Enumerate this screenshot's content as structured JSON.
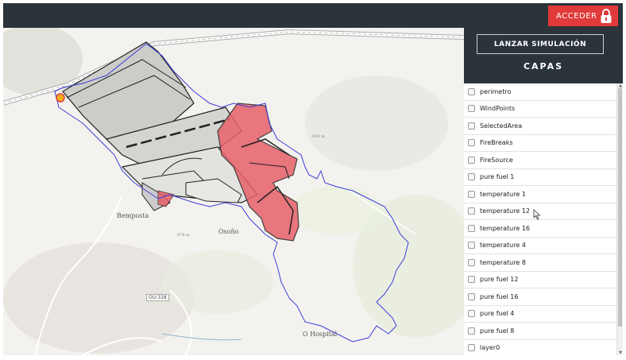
{
  "header": {
    "login_label": "ACCEDER",
    "login_icon": "padlock-icon"
  },
  "panel": {
    "simulate_label": "LANZAR SIMULACIÓN",
    "title": "CAPAS",
    "layers": [
      "perimetro",
      "WindPoints",
      "SelectedArea",
      "FireBreaks",
      "FireSource",
      "pure fuel 1",
      "temperature 1",
      "temperature 12",
      "temperature 16",
      "temperature 4",
      "temperature 8",
      "pure fuel 12",
      "pure fuel 16",
      "pure fuel 4",
      "pure fuel 8",
      "layer0"
    ]
  },
  "map": {
    "places": {
      "bemposta": "Bemposta",
      "osono": "Osoño",
      "hospital": "O Hospital"
    },
    "road_code": "OU-318",
    "elevations": [
      "690 m",
      "678 m"
    ],
    "colors": {
      "fire_area": "#e8606a",
      "perimeter": "#3a3fd8",
      "topbar": "#2b333b",
      "accent": "#e03a3a"
    }
  }
}
